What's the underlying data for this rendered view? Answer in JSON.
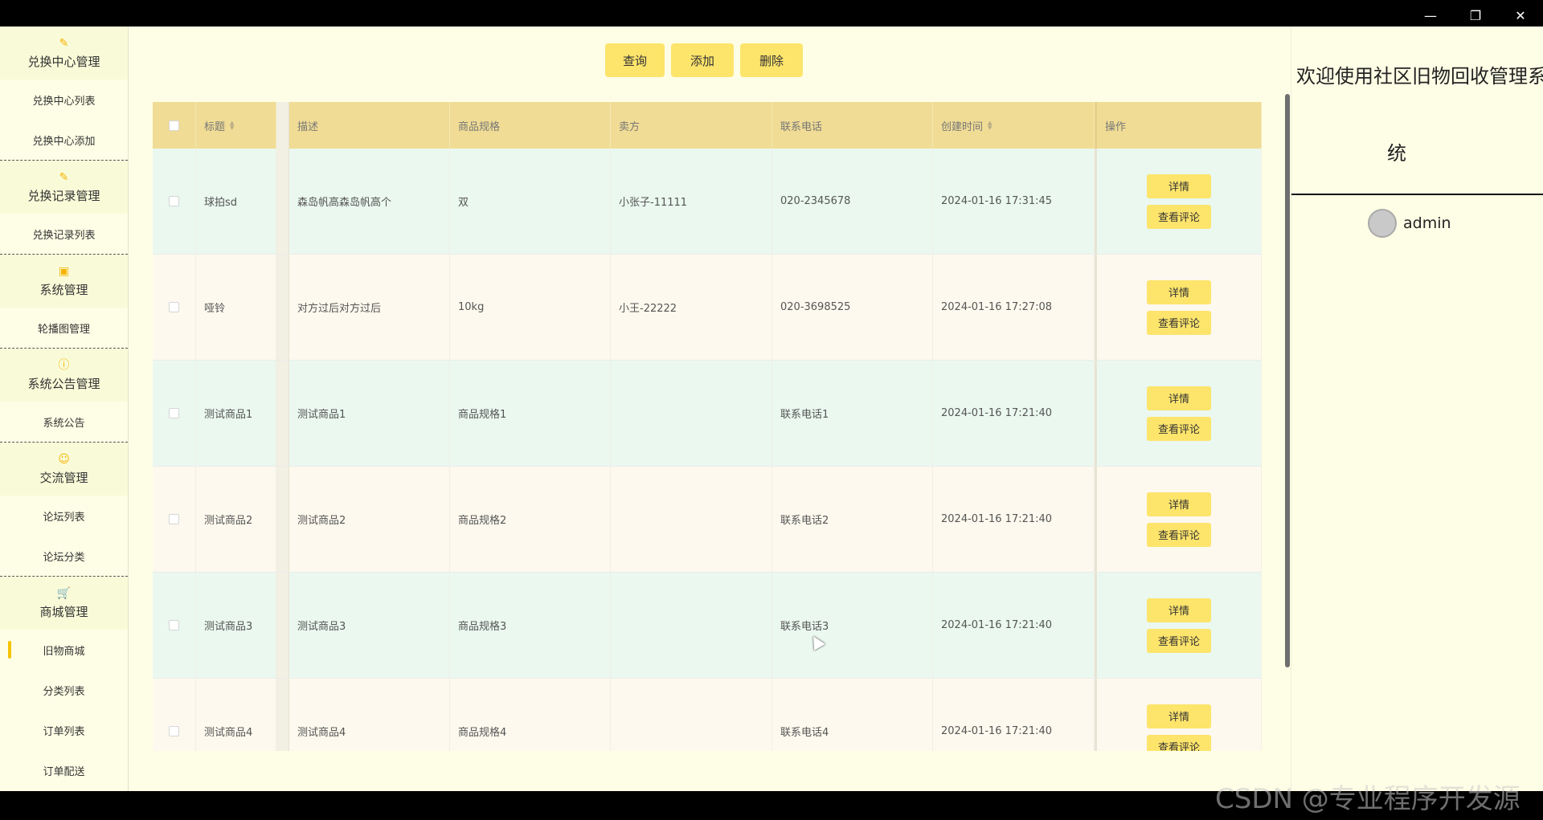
{
  "window": {
    "minimize_icon": "—",
    "restore_icon": "❐",
    "close_icon": "✕"
  },
  "sidebar": {
    "groups": [
      {
        "title": "兑换中心管理",
        "icon": "✎",
        "items": [
          "兑换中心列表",
          "兑换中心添加"
        ]
      },
      {
        "title": "兑换记录管理",
        "icon": "✎",
        "items": [
          "兑换记录列表"
        ]
      },
      {
        "title": "系统管理",
        "icon": "▣",
        "items": [
          "轮播图管理"
        ]
      },
      {
        "title": "系统公告管理",
        "icon": "ⓘ",
        "items": [
          "系统公告"
        ]
      },
      {
        "title": "交流管理",
        "icon": "☺",
        "items": [
          "论坛列表",
          "论坛分类"
        ]
      },
      {
        "title": "商城管理",
        "icon": "🛒",
        "items": [
          "旧物商城",
          "分类列表",
          "订单列表",
          "订单配送"
        ]
      }
    ]
  },
  "toolbar": {
    "query": "查询",
    "add": "添加",
    "delete": "删除"
  },
  "table": {
    "headers": [
      "标题",
      "描述",
      "商品规格",
      "卖方",
      "联系电话",
      "创建时间",
      "操作"
    ],
    "rows": [
      [
        "球拍sd",
        "森岛帆高森岛帆高个",
        "双",
        "小张子-11111",
        "020-2345678",
        "2024-01-16 17:31:45"
      ],
      [
        "哑铃",
        "对方过后对方过后",
        "10kg",
        "小王-22222",
        "020-3698525",
        "2024-01-16 17:27:08"
      ],
      [
        "测试商品1",
        "测试商品1",
        "商品规格1",
        "",
        "联系电话1",
        "2024-01-16 17:21:40"
      ],
      [
        "测试商品2",
        "测试商品2",
        "商品规格2",
        "",
        "联系电话2",
        "2024-01-16 17:21:40"
      ],
      [
        "测试商品3",
        "测试商品3",
        "商品规格3",
        "",
        "联系电话3",
        "2024-01-16 17:21:40"
      ],
      [
        "测试商品4",
        "测试商品4",
        "商品规格4",
        "",
        "联系电话4",
        "2024-01-16 17:21:40"
      ]
    ],
    "detail_label": "详情",
    "comments_label": "查看评论"
  },
  "right_panel": {
    "welcome_line1": "欢迎使用社区旧物回收管理系",
    "welcome_line2": "统",
    "username": "admin"
  },
  "watermark": "CSDN @专业程序开发源"
}
